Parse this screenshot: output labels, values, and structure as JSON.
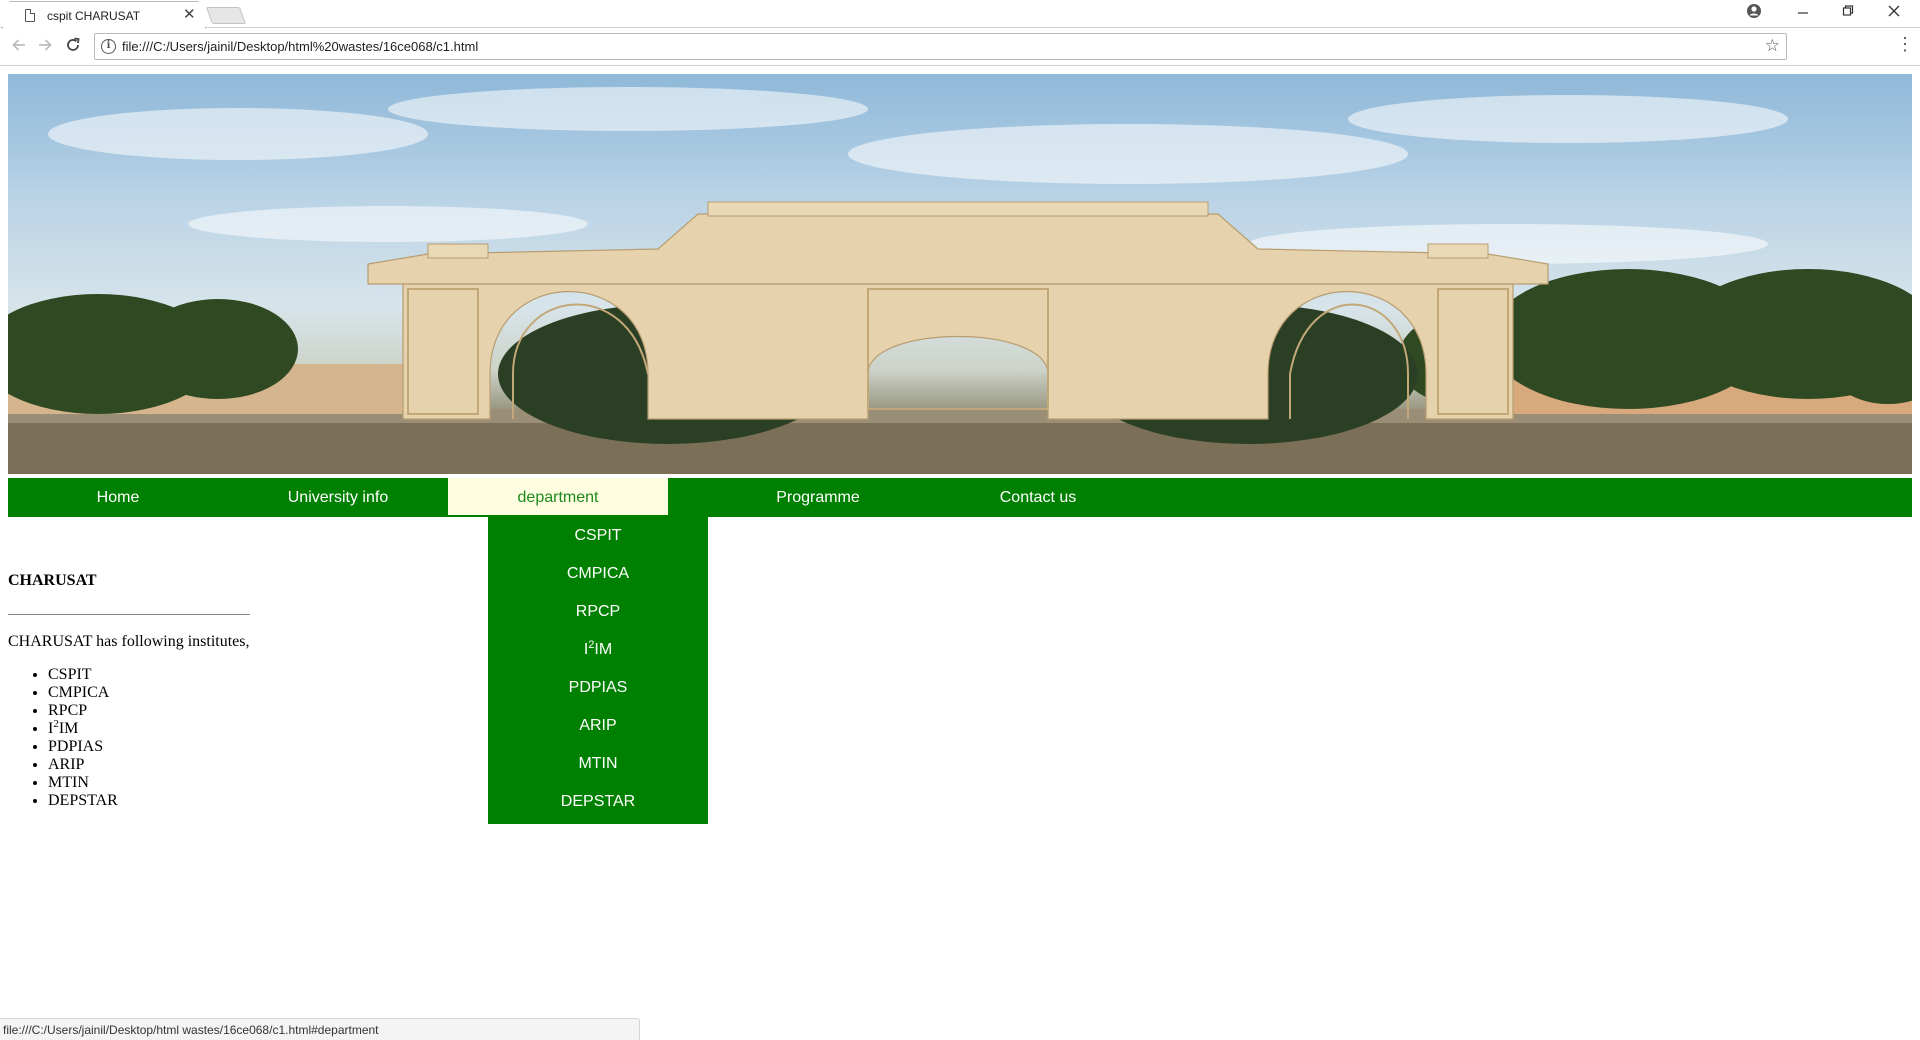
{
  "browser": {
    "tab_title": "cspit CHARUSAT",
    "tab_close": "✕",
    "url": "file:///C:/Users/jainil/Desktop/html%20wastes/16ce068/c1.html",
    "status_url": "file:///C:/Users/jainil/Desktop/html wastes/16ce068/c1.html#department",
    "icons": {
      "back": "back-arrow-icon",
      "forward": "forward-arrow-icon",
      "reload": "reload-icon",
      "info": "info-icon",
      "bookmark": "star-icon",
      "menu": "kebab-menu-icon",
      "account": "account-icon",
      "minimize": "minimize-icon",
      "restore": "restore-icon",
      "close": "close-icon"
    }
  },
  "nav": {
    "items": [
      {
        "label": "Home"
      },
      {
        "label": "University info"
      },
      {
        "label": "department"
      },
      {
        "label": "Programme"
      },
      {
        "label": "Contact us"
      }
    ]
  },
  "dropdown": {
    "items": [
      {
        "label": "CSPIT"
      },
      {
        "label": "CMPICA"
      },
      {
        "label": "RPCP"
      },
      {
        "label_base": "I",
        "label_sup": "2",
        "label_rest": "IM"
      },
      {
        "label": "PDPIAS"
      },
      {
        "label": "ARIP"
      },
      {
        "label": "MTIN"
      },
      {
        "label": "DEPSTAR"
      }
    ]
  },
  "content": {
    "heading": "CHARUSAT",
    "intro": "CHARUSAT has following institutes,",
    "institutes": [
      {
        "label": "CSPIT"
      },
      {
        "label": "CMPICA"
      },
      {
        "label": "RPCP"
      },
      {
        "label_base": "I",
        "label_sup": "2",
        "label_rest": "IM"
      },
      {
        "label": "PDPIAS"
      },
      {
        "label": "ARIP"
      },
      {
        "label": "MTIN"
      },
      {
        "label": "DEPSTAR"
      }
    ]
  },
  "colors": {
    "nav_green": "#008000",
    "nav_active_bg": "#fffde0",
    "nav_active_text": "#1c8a1c"
  }
}
